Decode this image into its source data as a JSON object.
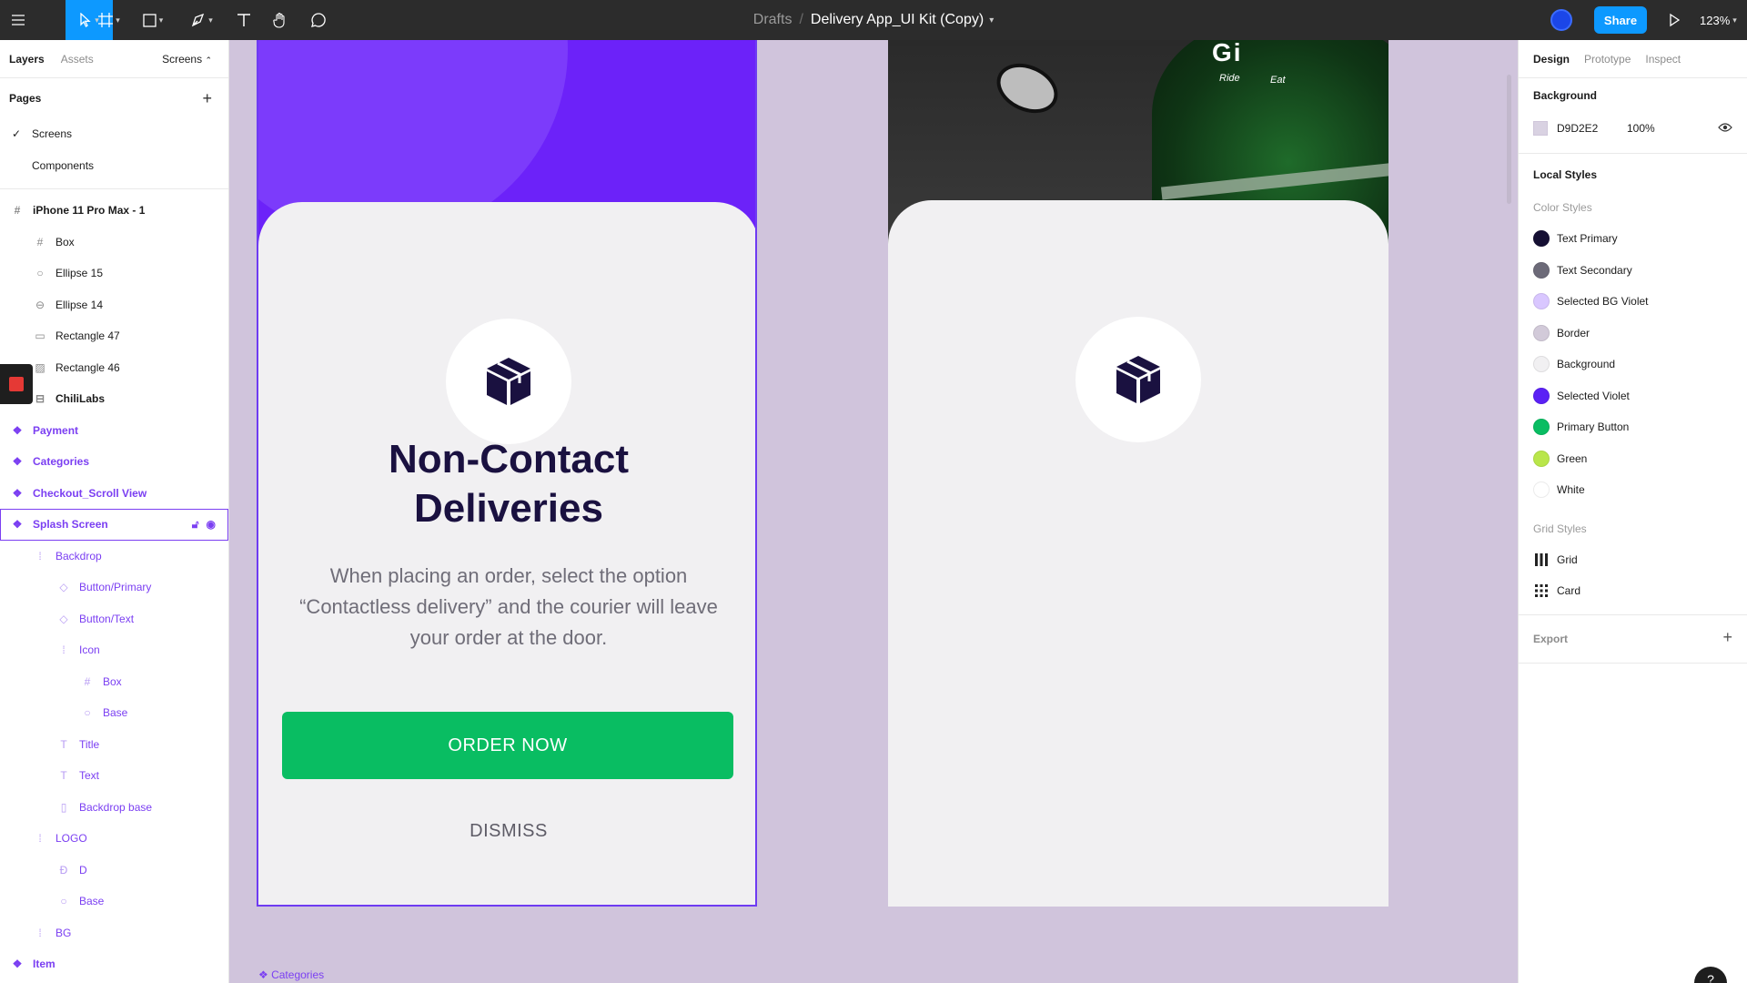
{
  "toolbar": {
    "menu_icon": "hamburger-icon",
    "breadcrumb_folder": "Drafts",
    "breadcrumb_separator": "/",
    "file_name": "Delivery App_UI Kit (Copy)",
    "share_label": "Share",
    "zoom": "123%"
  },
  "left_panel": {
    "tabs": [
      "Layers",
      "Assets"
    ],
    "pages_dropdown": "Screens",
    "pages_heading": "Pages",
    "pages": [
      {
        "label": "Screens",
        "selected": true
      },
      {
        "label": "Components",
        "selected": false
      }
    ],
    "layers": [
      {
        "label": "iPhone 11 Pro Max - 1",
        "icon": "frame-icon"
      },
      {
        "label": "Box",
        "icon": "frame-icon"
      },
      {
        "label": "Ellipse 15",
        "icon": "ellipse-icon"
      },
      {
        "label": "Ellipse 14",
        "icon": "ellipse-icon"
      },
      {
        "label": "Rectangle 47",
        "icon": "rectangle-icon"
      },
      {
        "label": "Rectangle 46",
        "icon": "image-icon"
      },
      {
        "label": "ChiliLabs",
        "icon": "group-icon"
      },
      {
        "label": "Payment",
        "icon": "component-icon"
      },
      {
        "label": "Categories",
        "icon": "component-icon"
      },
      {
        "label": "Checkout_Scroll View",
        "icon": "component-icon"
      },
      {
        "label": "Splash Screen",
        "icon": "component-icon"
      },
      {
        "label": "Backdrop",
        "icon": "group-icon"
      },
      {
        "label": "Button/Primary",
        "icon": "instance-icon"
      },
      {
        "label": "Button/Text",
        "icon": "instance-icon"
      },
      {
        "label": "Icon",
        "icon": "group-icon"
      },
      {
        "label": "Box",
        "icon": "frame-icon"
      },
      {
        "label": "Base",
        "icon": "ellipse-icon"
      },
      {
        "label": "Title",
        "icon": "text-icon"
      },
      {
        "label": "Text",
        "icon": "text-icon"
      },
      {
        "label": "Backdrop base",
        "icon": "rectangle-icon"
      },
      {
        "label": "LOGO",
        "icon": "group-icon"
      },
      {
        "label": "D",
        "icon": "vector-icon"
      },
      {
        "label": "Base",
        "icon": "ellipse-icon"
      },
      {
        "label": "BG",
        "icon": "group-icon"
      },
      {
        "label": "Item",
        "icon": "component-icon"
      }
    ]
  },
  "canvas": {
    "splash": {
      "title_line1": "Non-Contact",
      "title_line2": "Deliveries",
      "body": "When placing an order, select the option “Contactless delivery” and the courier will leave your order at the door.",
      "primary_button": "ORDER NOW",
      "secondary_button": "DISMISS"
    },
    "photo_text": {
      "logo": "Gi",
      "ride": "Ride",
      "eat": "Eat"
    },
    "bottom_label": "❖ Categories"
  },
  "right_panel": {
    "tabs": [
      "Design",
      "Prototype",
      "Inspect"
    ],
    "background_heading": "Background",
    "background_hex": "D9D2E2",
    "background_opacity": "100%",
    "local_styles_heading": "Local Styles",
    "color_styles_heading": "Color Styles",
    "color_styles": [
      {
        "name": "Text Primary",
        "color": "#150f33"
      },
      {
        "name": "Text Secondary",
        "color": "#6c6a78"
      },
      {
        "name": "Selected BG Violet",
        "color": "#d9c7ff"
      },
      {
        "name": "Border",
        "color": "#d2cad9"
      },
      {
        "name": "Background",
        "color": "#f1f0f2"
      },
      {
        "name": "Selected Violet",
        "color": "#5b21f5"
      },
      {
        "name": "Primary Button",
        "color": "#09bd62"
      },
      {
        "name": "Green",
        "color": "#b9e64a"
      },
      {
        "name": "White",
        "color": "#ffffff"
      }
    ],
    "grid_styles_heading": "Grid Styles",
    "grid_styles": [
      "Grid",
      "Card"
    ],
    "export_label": "Export"
  },
  "help_label": "?"
}
